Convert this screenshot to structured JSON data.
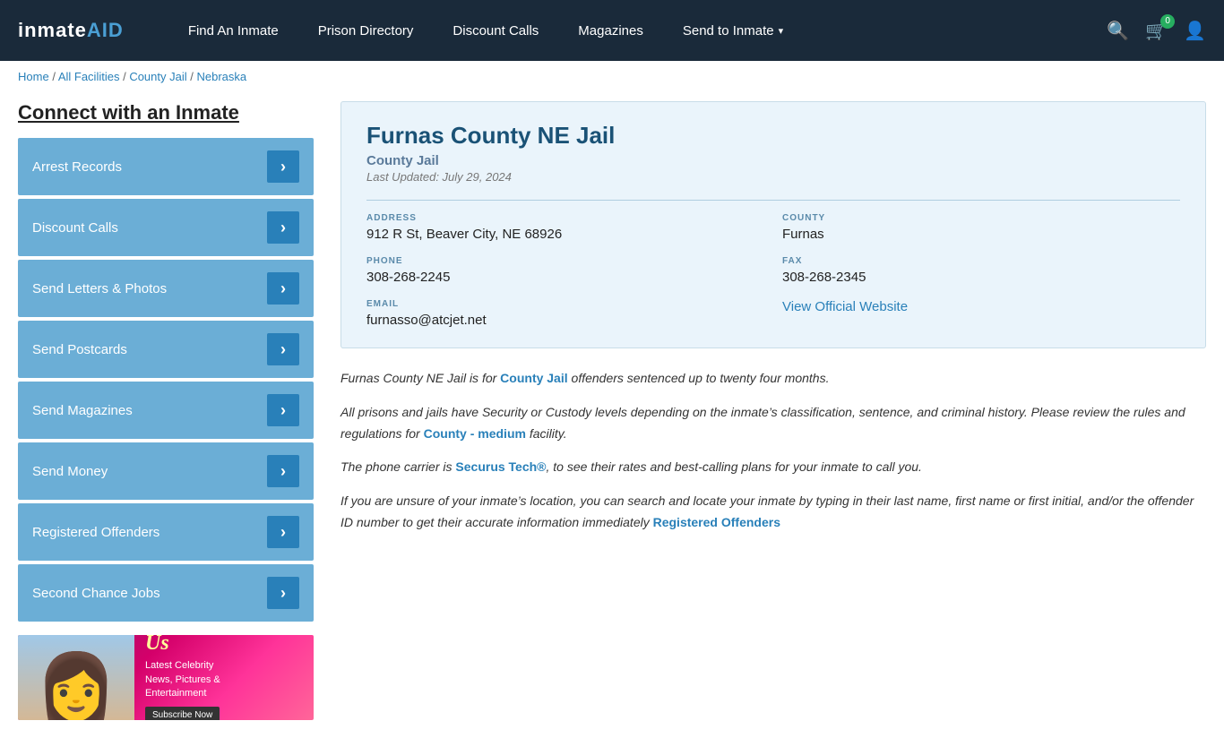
{
  "header": {
    "logo": "inmateAID",
    "nav": [
      {
        "label": "Find An Inmate",
        "id": "find-inmate"
      },
      {
        "label": "Prison Directory",
        "id": "prison-directory"
      },
      {
        "label": "Discount Calls",
        "id": "discount-calls"
      },
      {
        "label": "Magazines",
        "id": "magazines"
      },
      {
        "label": "Send to Inmate",
        "id": "send-to-inmate",
        "hasChevron": true
      }
    ],
    "cart_count": "0"
  },
  "breadcrumb": {
    "items": [
      {
        "label": "Home",
        "href": "#"
      },
      {
        "label": "All Facilities",
        "href": "#"
      },
      {
        "label": "County Jail",
        "href": "#"
      },
      {
        "label": "Nebraska",
        "href": "#"
      }
    ]
  },
  "sidebar": {
    "title": "Connect with an Inmate",
    "menu": [
      {
        "label": "Arrest Records"
      },
      {
        "label": "Discount Calls"
      },
      {
        "label": "Send Letters & Photos"
      },
      {
        "label": "Send Postcards"
      },
      {
        "label": "Send Magazines"
      },
      {
        "label": "Send Money"
      },
      {
        "label": "Registered Offenders"
      },
      {
        "label": "Second Chance Jobs"
      }
    ]
  },
  "ad": {
    "logo": "Us",
    "tagline": "Latest Celebrity\nNews, Pictures &\nEntertainment",
    "subscribe": "Subscribe Now"
  },
  "facility": {
    "name": "Furnas County NE Jail",
    "type": "County Jail",
    "last_updated": "Last Updated: July 29, 2024",
    "address_label": "ADDRESS",
    "address_value": "912 R St, Beaver City, NE 68926",
    "county_label": "COUNTY",
    "county_value": "Furnas",
    "phone_label": "PHONE",
    "phone_value": "308-268-2245",
    "fax_label": "FAX",
    "fax_value": "308-268-2345",
    "email_label": "EMAIL",
    "email_value": "furnasso@atcjet.net",
    "website_label": "View Official Website",
    "website_href": "#"
  },
  "description": {
    "para1_pre": "Furnas County NE Jail is for ",
    "para1_link": "County Jail",
    "para1_post": " offenders sentenced up to twenty four months.",
    "para2": "All prisons and jails have Security or Custody levels depending on the inmate’s classification, sentence, and criminal history. Please review the rules and regulations for ",
    "para2_link": "County - medium",
    "para2_post": " facility.",
    "para3_pre": "The phone carrier is ",
    "para3_link": "Securus Tech®",
    "para3_post": ", to see their rates and best-calling plans for your inmate to call you.",
    "para4": "If you are unsure of your inmate’s location, you can search and locate your inmate by typing in their last name, first name or first initial, and/or the offender ID number to get their accurate information immediately ",
    "para4_link": "Registered Offenders"
  }
}
